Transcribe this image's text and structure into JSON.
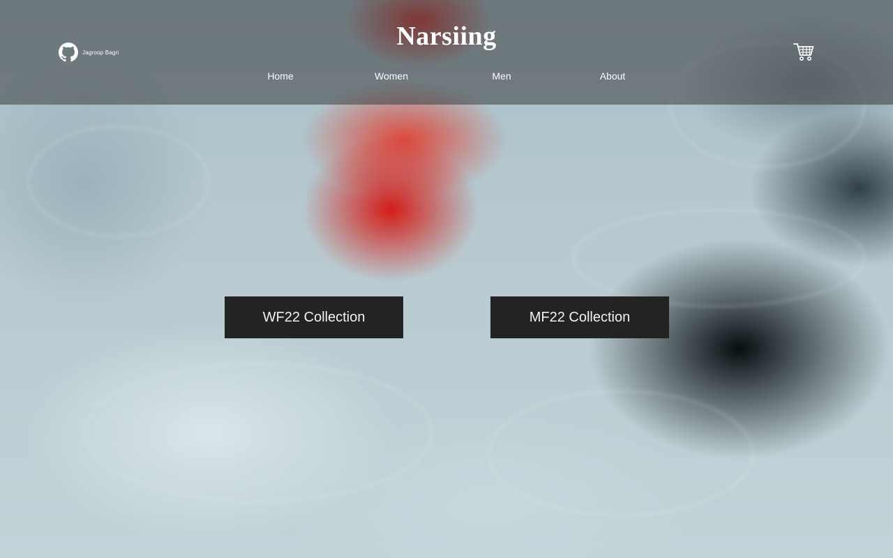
{
  "header": {
    "github": {
      "icon": "github-icon",
      "label": "Jagroop Bagri"
    },
    "brand": "Narsiing",
    "nav": [
      {
        "label": "Home"
      },
      {
        "label": "Women"
      },
      {
        "label": "Men"
      },
      {
        "label": "About"
      }
    ],
    "cart": {
      "icon": "cart-icon"
    }
  },
  "hero": {
    "buttons": [
      {
        "label": "WF22 Collection"
      },
      {
        "label": "MF22 Collection"
      }
    ]
  },
  "colors": {
    "header_overlay": "#3c3e40",
    "button_bg": "#232323",
    "button_text": "#f2f2f2",
    "accent_smoke": "#d6140e"
  }
}
